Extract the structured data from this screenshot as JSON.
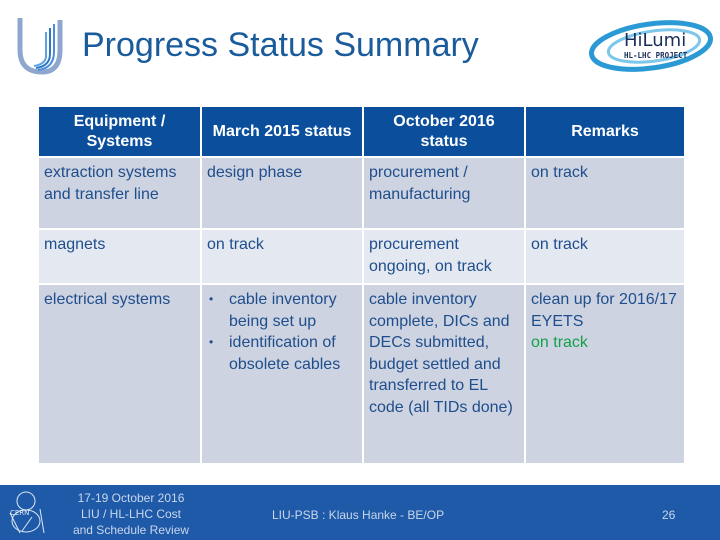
{
  "header": {
    "title": "Progress Status Summary",
    "logo_left": "LIU U logo",
    "logo_right": {
      "main": "HiLumi",
      "sub": "HL-LHC PROJECT"
    }
  },
  "table": {
    "columns": [
      "Equipment / Systems",
      "March 2015 status",
      "October 2016 status",
      "Remarks"
    ],
    "rows": [
      {
        "equipment": "extraction systems and transfer line",
        "march_2015": "design phase",
        "october_2016": "procurement / manufacturing",
        "remarks": "on track"
      },
      {
        "equipment": "magnets",
        "march_2015": "on track",
        "october_2016": "procurement ongoing, on track",
        "remarks": "on track"
      },
      {
        "equipment": "electrical systems",
        "march_2015_bullets": [
          "cable inventory being set up",
          "identification of obsolete cables"
        ],
        "october_2016": "cable inventory complete, DICs and DECs submitted, budget settled and transferred to EL code (all TIDs done)",
        "remarks": "clean up for 2016/17 EYETS",
        "remarks_status": "on track"
      }
    ]
  },
  "footer": {
    "logo": "CERN",
    "date_line1": "17-19 October 2016",
    "date_line2": "LIU / HL-LHC  Cost",
    "date_line3": "and Schedule Review",
    "author": "LIU-PSB : Klaus Hanke - BE/OP",
    "page": "26"
  },
  "colors": {
    "title": "#1a5b9c",
    "header_bg": "#0b4f9c",
    "row_dark": "#cdd3e0",
    "row_light": "#e4e8f0",
    "text": "#1f4e8c",
    "on_track": "#13a04a",
    "footer_bg": "#1e5aa8"
  }
}
